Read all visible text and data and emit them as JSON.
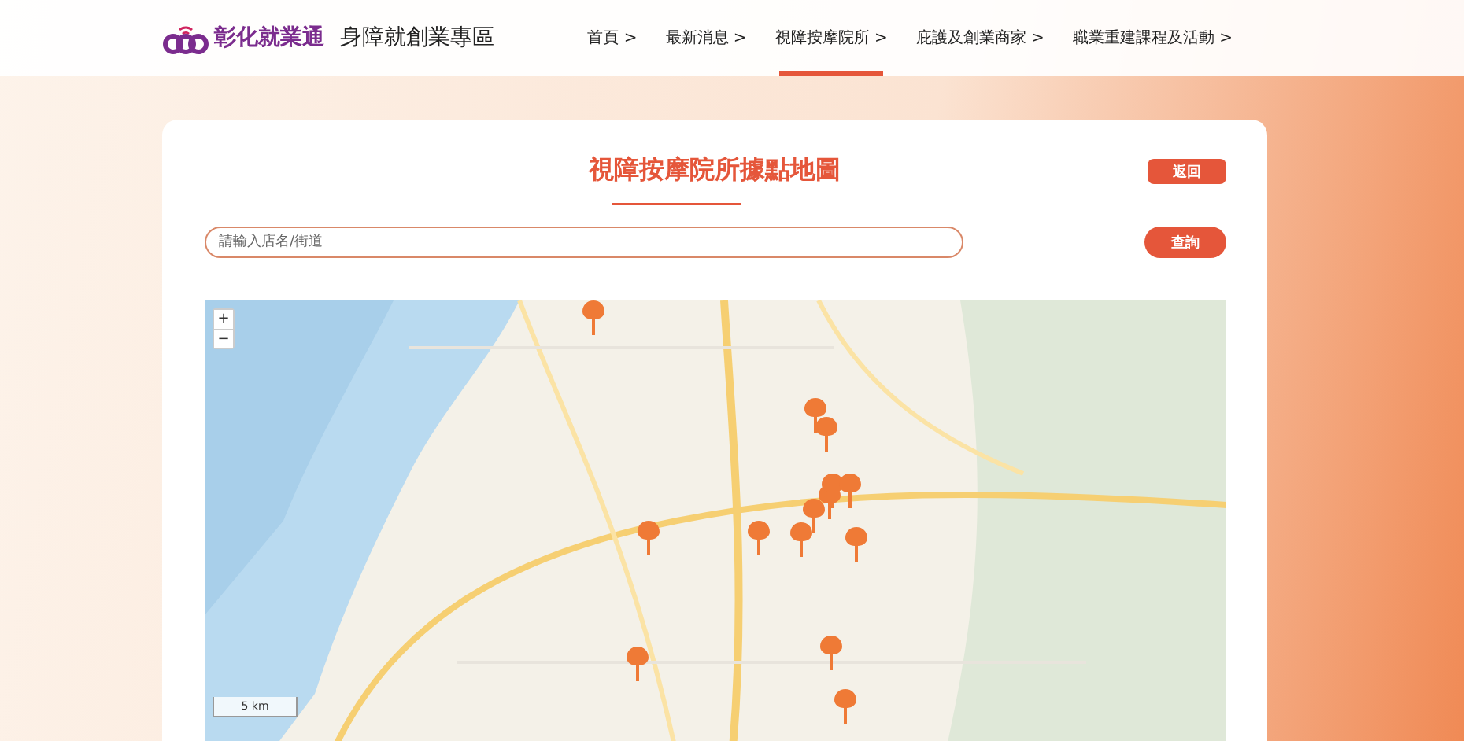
{
  "header": {
    "logo_text": "彰化就業通",
    "section_title": "身障就創業專區",
    "nav": [
      {
        "label": "首頁 >",
        "selected": false
      },
      {
        "label": "最新消息 >",
        "selected": false
      },
      {
        "label": "視障按摩院所 >",
        "selected": true
      },
      {
        "label": "庇護及創業商家 >",
        "selected": false
      },
      {
        "label": "職業重建課程及活動 >",
        "selected": false
      }
    ]
  },
  "page": {
    "title": "視障按摩院所據點地圖",
    "back_button": "返回",
    "search": {
      "placeholder": "請輸入店名/街道",
      "button": "查詢"
    }
  },
  "map": {
    "zoom_in": "+",
    "zoom_out": "−",
    "scale": "5 km"
  }
}
